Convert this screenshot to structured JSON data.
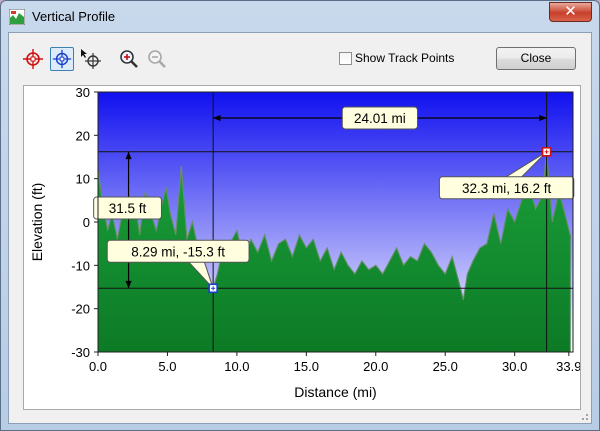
{
  "window": {
    "title": "Vertical Profile",
    "close_glyph": "✕"
  },
  "toolbar": {
    "tools": [
      {
        "icon": "red-crosshair-icon"
      },
      {
        "icon": "blue-crosshair-icon",
        "active": true
      },
      {
        "icon": "crosshair-cursor-icon"
      },
      {
        "icon": "zoom-in-icon"
      },
      {
        "icon": "zoom-out-icon"
      }
    ],
    "show_track_points_label": "Show Track Points",
    "show_track_points_checked": false,
    "close_label": "Close"
  },
  "chart_data": {
    "type": "area",
    "xlabel": "Distance   (mi)",
    "ylabel": "Elevation (ft)",
    "xlim": [
      0,
      34.2
    ],
    "ylim": [
      -30,
      30
    ],
    "xticks": [
      "0.0",
      "5.0",
      "10.0",
      "15.0",
      "20.0",
      "25.0",
      "30.0",
      "33.9"
    ],
    "xtick_values": [
      0,
      5,
      10,
      15,
      20,
      25,
      30,
      33.9
    ],
    "yticks": [
      "30",
      "20",
      "10",
      "0",
      "-10",
      "-20",
      "-30"
    ],
    "ytick_values": [
      30,
      20,
      10,
      0,
      -10,
      -20,
      -30
    ],
    "background": {
      "top": "#1010f0",
      "bottom": "#ffffff"
    },
    "fill_color": "#1aa03a",
    "series": [
      {
        "x": [
          0,
          0.3,
          0.7,
          1.0,
          1.4,
          1.8,
          2.2,
          2.6,
          3.0,
          3.4,
          3.8,
          4.2,
          4.6,
          4.9,
          5.2,
          5.6,
          6.0,
          6.4,
          6.8,
          7.2,
          7.6,
          8.0,
          8.29,
          8.6,
          9.0,
          9.5,
          10.0,
          10.5,
          11.0,
          11.5,
          12.0,
          12.5,
          13.0,
          13.5,
          14.0,
          14.5,
          15.0,
          15.5,
          16.0,
          16.5,
          17.0,
          17.5,
          18.0,
          18.5,
          19.0,
          19.5,
          20.0,
          20.5,
          21.0,
          21.5,
          22.0,
          22.5,
          23.0,
          23.5,
          24.0,
          24.5,
          25.0,
          25.5,
          26.0,
          26.3,
          26.6,
          27.0,
          27.5,
          28.0,
          28.5,
          29.0,
          29.5,
          30.0,
          30.5,
          31.0,
          31.5,
          32.0,
          32.3,
          32.7,
          33.2,
          33.6,
          34.0
        ],
        "y": [
          12,
          5,
          -2,
          2,
          -4,
          3,
          0,
          6,
          -3,
          7,
          2,
          -2,
          4,
          8,
          2,
          -3,
          13,
          -4,
          0,
          -6,
          -10,
          -13,
          -15.3,
          -12,
          -6,
          -5,
          -2,
          -9,
          -4,
          -7,
          -3,
          -9,
          -5,
          -4,
          -8,
          -3,
          -6,
          -4,
          -9,
          -6,
          -11,
          -7,
          -10,
          -12,
          -9,
          -11,
          -10,
          -12,
          -9,
          -6,
          -10,
          -8,
          -9,
          -5,
          -7,
          -10,
          -12,
          -8,
          -14,
          -18,
          -12,
          -9,
          -6,
          -5,
          2,
          -5,
          3,
          0,
          5,
          9,
          3,
          6,
          16.2,
          0,
          7,
          2,
          -3
        ]
      }
    ],
    "annotations": [
      {
        "text": "24.01 mi",
        "kind": "horizontal-distance",
        "x1": 8.29,
        "x2": 32.3,
        "y": 24
      },
      {
        "text": "31.5 ft",
        "kind": "vertical-distance",
        "x": 2.2,
        "y1": -15.3,
        "y2": 16.2
      },
      {
        "text": "8.29 mi, -15.3 ft",
        "kind": "point-callout",
        "x": 8.29,
        "y": -15.3,
        "marker_color": "#1a3fcc"
      },
      {
        "text": "32.3 mi, 16.2 ft",
        "kind": "point-callout",
        "x": 32.3,
        "y": 16.2,
        "marker_color": "#d01010"
      }
    ]
  }
}
